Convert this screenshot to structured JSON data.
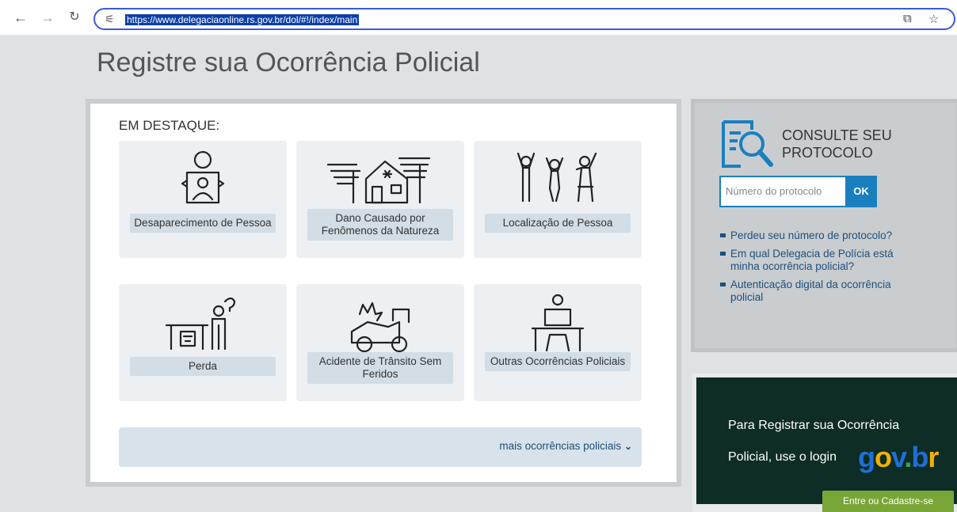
{
  "browser": {
    "back_icon": "arrow-left-icon",
    "forward_icon": "arrow-right-icon",
    "reload_icon": "reload-icon",
    "url": "https://www.delegaciaonline.rs.gov.br/dol/#!/index/main"
  },
  "page": {
    "title": "Registre sua Ocorrência Policial"
  },
  "destaque": {
    "heading": "EM DESTAQUE:",
    "tiles": [
      {
        "label": "Desaparecimento de Pessoa",
        "icon": "missing-person-icon"
      },
      {
        "label": "Dano Causado por Fenômenos da Natureza",
        "icon": "storm-house-icon"
      },
      {
        "label": "Localização de Pessoa",
        "icon": "people-group-icon"
      },
      {
        "label": "Perda",
        "icon": "lost-item-icon"
      },
      {
        "label": "Acidente de Trânsito Sem Feridos",
        "icon": "car-crash-icon"
      },
      {
        "label": "Outras Ocorrências Policiais",
        "icon": "person-at-desk-icon"
      }
    ],
    "mais": "mais ocorrências policiais"
  },
  "protocolo": {
    "title": "CONSULTE SEU PROTOCOLO",
    "placeholder": "Número do protocolo",
    "ok": "OK",
    "links": [
      "Perdeu seu número de protocolo?",
      "Em qual Delegacia de Polícia está minha ocorrência policial?",
      "Autenticação digital da ocorrência policial"
    ]
  },
  "govbr": {
    "line1": "Para Registrar sua Ocorrência",
    "line2": "Policial, use o login",
    "logo": "gov.br",
    "button": "Entre ou Cadastre-se"
  },
  "colors": {
    "accent": "#1a7fbf",
    "dark_green": "#0d2d26",
    "green_button": "#78a637"
  }
}
